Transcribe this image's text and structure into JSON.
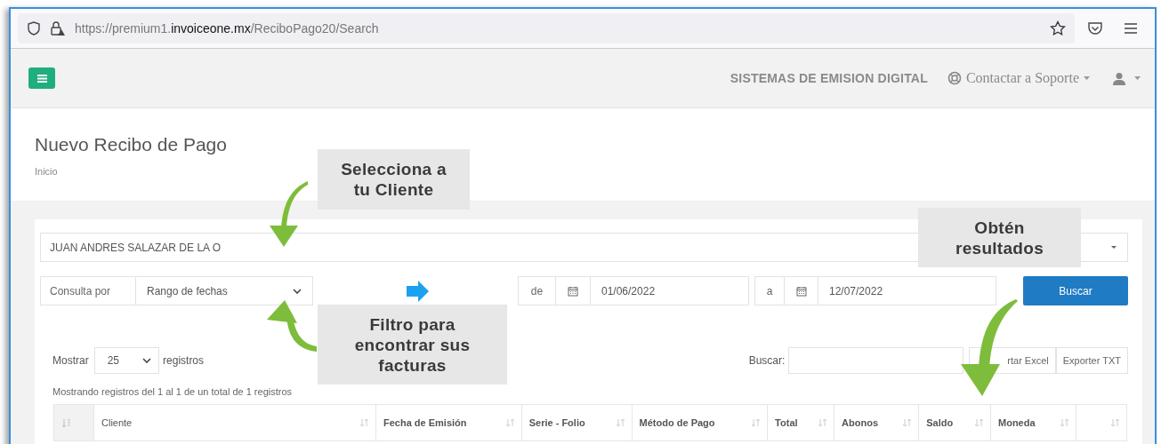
{
  "browser": {
    "url": "https://premium1.**invoiceone.mx**/ReciboPago20/Search"
  },
  "navbar": {
    "brand": "SISTEMAS DE EMISION DIGITAL",
    "support": "Contactar a Soporte"
  },
  "page": {
    "title": "Nuevo Recibo de Pago",
    "breadcrumb": "Inicio"
  },
  "form": {
    "client": "JUAN ANDRES SALAZAR DE LA O",
    "query_label": "Consulta por",
    "query_type": "Rango de fechas",
    "from_label": "de",
    "from_date": "01/06/2022",
    "to_label": "a",
    "to_date": "12/07/2022",
    "search_button": "Buscar"
  },
  "table_controls": {
    "show_label": "Mostrar",
    "page_size": "25",
    "records_label": "registros",
    "search_label": "Buscar:",
    "export_buttons": [
      "rtar Excel",
      "Exporter TXT"
    ],
    "info": "Mostrando registros del 1 al 1 de un total de 1 registros"
  },
  "table": {
    "columns": [
      {
        "label": "Cliente"
      },
      {
        "label": "Fecha de Emisión"
      },
      {
        "label": "Serie - Folio"
      },
      {
        "label": "Método de Pago"
      },
      {
        "label": "Total"
      },
      {
        "label": "Abonos"
      },
      {
        "label": "Saldo"
      },
      {
        "label": "Moneda"
      }
    ]
  },
  "callouts": [
    {
      "text": "Selecciona a tu Cliente"
    },
    {
      "text": "Filtro para encontrar sus facturas"
    },
    {
      "text": "Obtén resultados"
    }
  ]
}
